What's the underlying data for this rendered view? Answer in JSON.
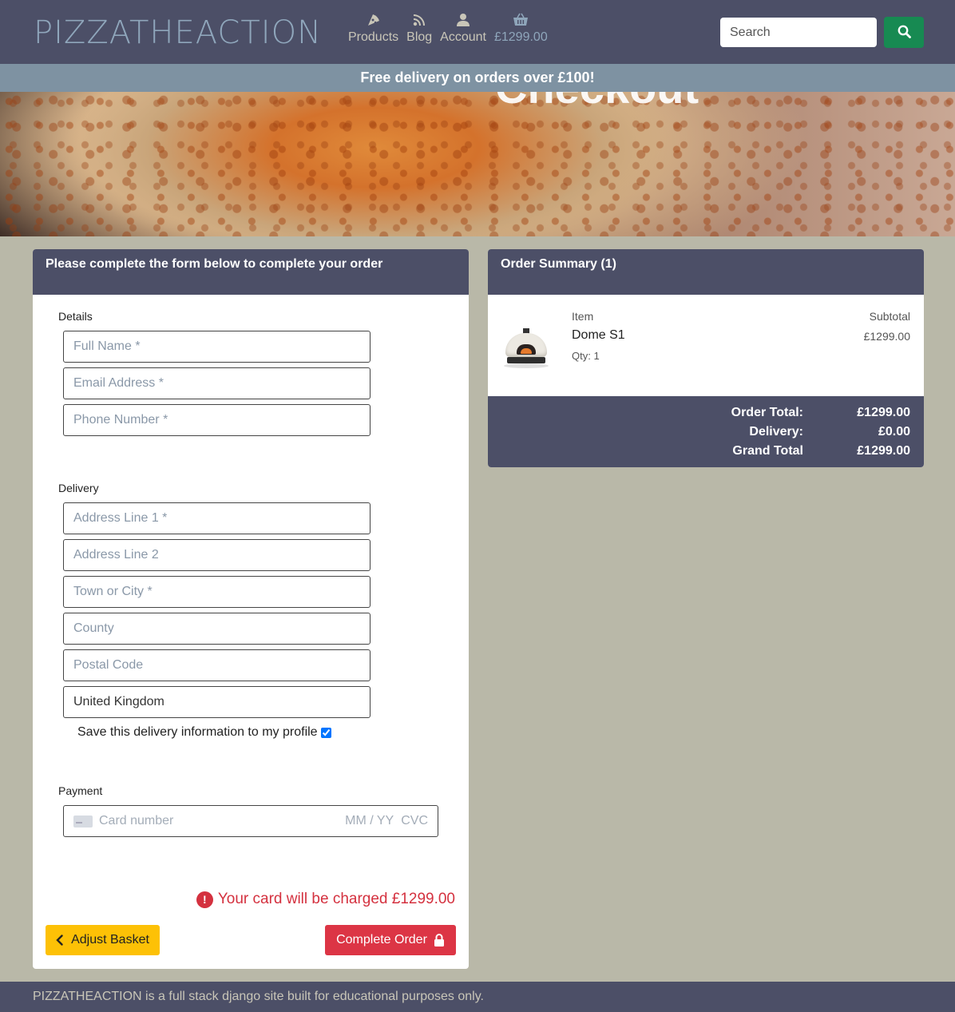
{
  "nav": {
    "brand": "PIZZATHEACTION",
    "links": [
      {
        "label": "Products",
        "icon": "pizza-slice-icon"
      },
      {
        "label": "Blog",
        "icon": "rss-icon"
      },
      {
        "label": "Account",
        "icon": "user-icon"
      },
      {
        "label": "£1299.00",
        "icon": "basket-icon"
      }
    ],
    "search_placeholder": "Search"
  },
  "banner": "Free delivery on orders over £100!",
  "hero": {
    "title": "Checkout"
  },
  "form": {
    "header": "Please complete the form below to complete your order",
    "details_label": "Details",
    "full_name_ph": "Full Name *",
    "email_ph": "Email Address *",
    "phone_ph": "Phone Number *",
    "delivery_label": "Delivery",
    "address1_ph": "Address Line 1 *",
    "address2_ph": "Address Line 2",
    "town_ph": "Town or City *",
    "county_ph": "County",
    "postcode_ph": "Postal Code",
    "country_value": "United Kingdom",
    "save_label": "Save this delivery information to my profile",
    "payment_label": "Payment",
    "card_number_ph": "Card number",
    "card_expiry_ph": "MM / YY",
    "card_cvc_ph": "CVC",
    "charge_note": "Your card will be charged £1299.00",
    "adjust_label": "Adjust Basket",
    "complete_label": "Complete Order"
  },
  "summary": {
    "header": "Order Summary (1)",
    "item_header": "Item",
    "subtotal_header": "Subtotal",
    "item": {
      "name": "Dome S1",
      "qty": "Qty: 1",
      "subtotal": "£1299.00"
    },
    "order_total_label": "Order Total:",
    "order_total": "£1299.00",
    "delivery_label": "Delivery:",
    "delivery": "£0.00",
    "grand_total_label": "Grand Total",
    "grand_total": "£1299.00"
  },
  "footer": "PIZZATHEACTION is a full stack django site built for educational purposes only.",
  "colors": {
    "nav": "#4c4f67",
    "banner": "#7e92a2",
    "page_bg": "#b9b8a8",
    "search_btn": "#178a52",
    "adjust_btn": "#fdc106",
    "complete_btn": "#dc3545",
    "charge_note": "#d4313f"
  }
}
